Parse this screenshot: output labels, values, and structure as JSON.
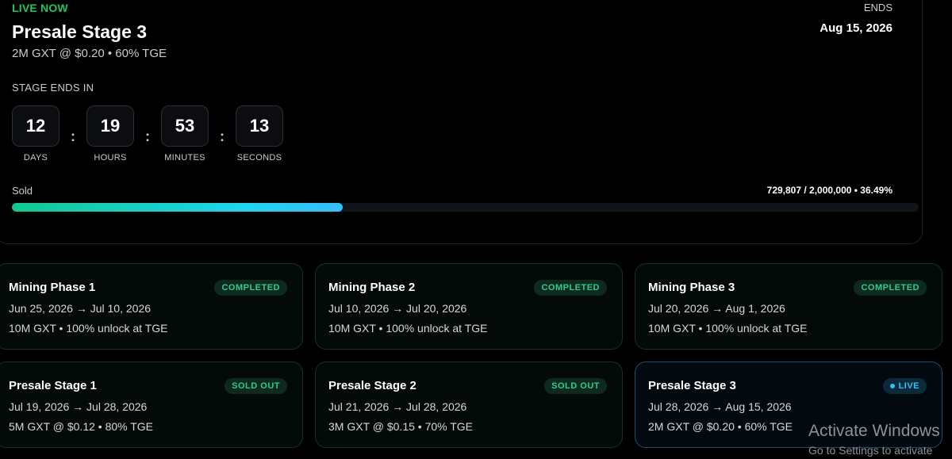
{
  "hero": {
    "status": "LIVE NOW",
    "title": "Presale Stage 3",
    "subtitle": "2M GXT @ $0.20 • 60% TGE",
    "ends_label": "ENDS",
    "ends_date": "Aug 15, 2026",
    "countdown_label": "STAGE ENDS IN",
    "countdown": [
      {
        "value": "12",
        "unit": "DAYS"
      },
      {
        "value": "19",
        "unit": "HOURS"
      },
      {
        "value": "53",
        "unit": "MINUTES"
      },
      {
        "value": "13",
        "unit": "SECONDS"
      }
    ],
    "separator": ":",
    "sold_label": "Sold",
    "sold_value": "729,807 / 2,000,000 • 36.49%",
    "sold_fraction": 0.3649
  },
  "stages": [
    {
      "title": "Mining Phase 1",
      "dates": "Jun 25, 2026 → Jul 10, 2026",
      "info": "10M GXT • 100% unlock at TGE",
      "badge": "COMPLETED",
      "badge_type": "completed"
    },
    {
      "title": "Mining Phase 2",
      "dates": "Jul 10, 2026 → Jul 20, 2026",
      "info": "10M GXT • 100% unlock at TGE",
      "badge": "COMPLETED",
      "badge_type": "completed"
    },
    {
      "title": "Mining Phase 3",
      "dates": "Jul 20, 2026 → Aug 1, 2026",
      "info": "10M GXT • 100% unlock at TGE",
      "badge": "COMPLETED",
      "badge_type": "completed"
    },
    {
      "title": "Presale Stage 1",
      "dates": "Jul 19, 2026 → Jul 28, 2026",
      "info": "5M GXT @ $0.12 • 80% TGE",
      "badge": "SOLD OUT",
      "badge_type": "soldout"
    },
    {
      "title": "Presale Stage 2",
      "dates": "Jul 21, 2026 → Jul 28, 2026",
      "info": "3M GXT @ $0.15 • 70% TGE",
      "badge": "SOLD OUT",
      "badge_type": "soldout"
    },
    {
      "title": "Presale Stage 3",
      "dates": "Jul 28, 2026 → Aug 15, 2026",
      "info": "2M GXT @ $0.20 • 60% TGE",
      "badge": "LIVE",
      "badge_type": "live"
    }
  ],
  "watermark": {
    "title": "Activate Windows",
    "subtitle": "Go to Settings to activate"
  },
  "colors": {
    "accent_green": "#22c55e",
    "accent_cyan": "#38bdf8",
    "background": "#000000"
  }
}
